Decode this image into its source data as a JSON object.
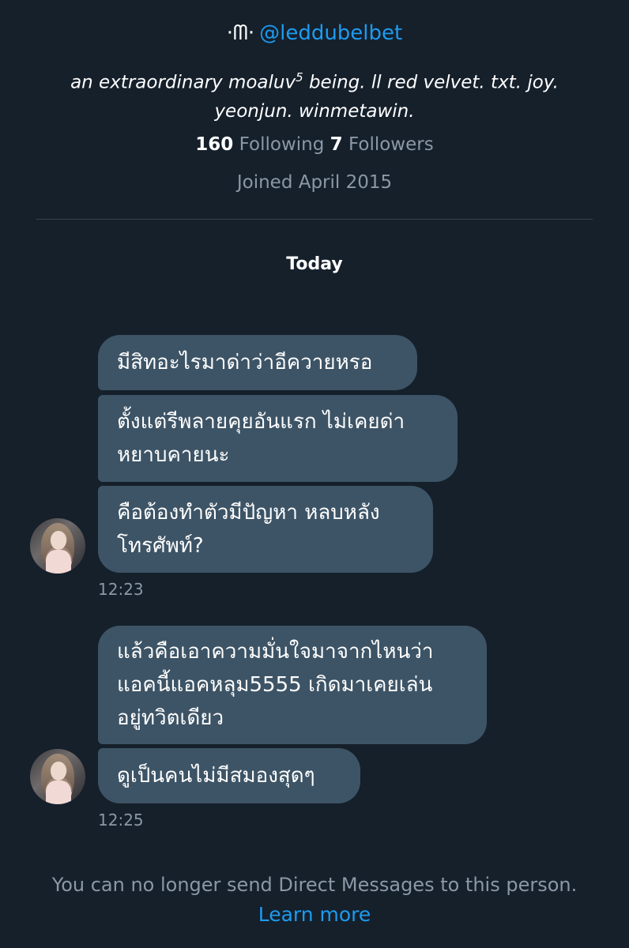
{
  "profile": {
    "glyph": "·ᗰ·",
    "handle": "@leddubelbet",
    "bio_line1_pre": "an extraordinary moaluv",
    "bio_sup": "5",
    "bio_line1_post": " being. ll red velvet. txt. joy.",
    "bio_line2": "yeonjun. winmetawin.",
    "following_count": "160",
    "following_label": "Following",
    "followers_count": "7",
    "followers_label": "Followers",
    "joined": "Joined April 2015"
  },
  "conversation": {
    "day_label": "Today",
    "groups": [
      {
        "time": "12:23",
        "messages": [
          {
            "lines": [
              "มีสิทอะไรมาด่าว่าอีควายหรอ"
            ]
          },
          {
            "lines": [
              "ตั้งแต่รีพลายคุยอันแรก ไม่เคยด่า",
              "หยาบคายนะ"
            ]
          },
          {
            "lines": [
              "คือต้องทำตัวมีปัญหา หลบหลัง",
              "โทรศัพท์?"
            ]
          }
        ]
      },
      {
        "time": "12:25",
        "messages": [
          {
            "lines": [
              "แล้วคือเอาความมั่นใจมาจากไหนว่า",
              "แอคนี้แอคหลุม5555 เกิดมาเคยเล่น",
              "อยู่ทวิตเดียว"
            ]
          },
          {
            "lines": [
              "ดูเป็นคนไม่มีสมองสุดๆ"
            ]
          }
        ]
      }
    ]
  },
  "footer": {
    "notice": "You can no longer send Direct Messages to this person.",
    "learn_more": "Learn more"
  },
  "colors": {
    "background": "#15202b",
    "bubble": "#3d5466",
    "accent": "#1d9bf0",
    "muted": "#8b98a5"
  }
}
